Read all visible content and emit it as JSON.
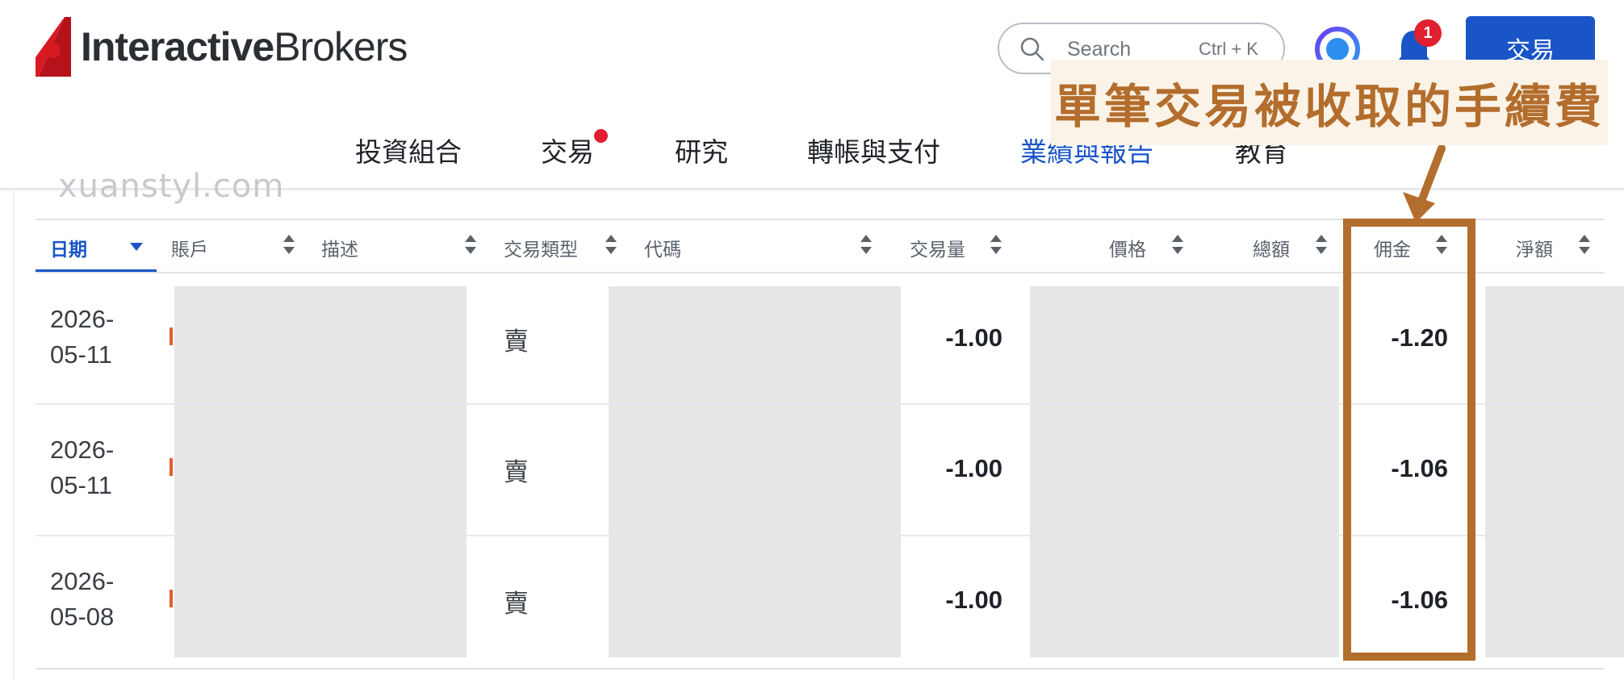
{
  "brand": {
    "logo_bold": "Interactive",
    "logo_regular": "Brokers"
  },
  "search": {
    "placeholder": "Search",
    "shortcut": "Ctrl + K"
  },
  "notifications": {
    "count": "1"
  },
  "header": {
    "trade_button": "交易"
  },
  "nav": [
    {
      "label": "投資組合"
    },
    {
      "label": "交易"
    },
    {
      "label": "研究"
    },
    {
      "label": "轉帳與支付"
    },
    {
      "label": "業績與報告"
    },
    {
      "label": "教育"
    }
  ],
  "watermark": "xuanstyl.com",
  "annotation": {
    "text": "單筆交易被收取的手續費",
    "color": "#b36d2c"
  },
  "table": {
    "columns": [
      "日期",
      "賬戶",
      "描述",
      "交易類型",
      "代碼",
      "交易量",
      "價格",
      "總額",
      "佣金",
      "淨額"
    ],
    "rows": [
      {
        "date_line1": "2026-",
        "date_line2": "05-11",
        "type": "賣",
        "quantity": "-1.00",
        "commission": "-1.20"
      },
      {
        "date_line1": "2026-",
        "date_line2": "05-11",
        "type": "賣",
        "quantity": "-1.00",
        "commission": "-1.06"
      },
      {
        "date_line1": "2026-",
        "date_line2": "05-08",
        "type": "賣",
        "quantity": "-1.00",
        "commission": "-1.06"
      }
    ]
  },
  "colors": {
    "accent": "#1a55c7",
    "badge": "#e02030",
    "annotation": "#b36d2c"
  }
}
